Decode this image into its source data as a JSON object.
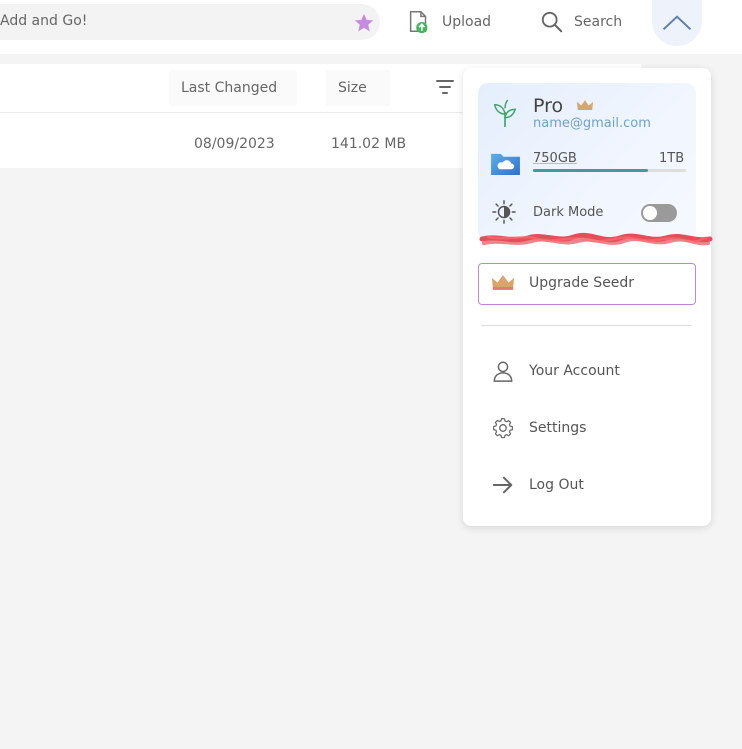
{
  "topbar": {
    "add_placeholder": "Add and Go!",
    "upload_label": "Upload",
    "search_label": "Search"
  },
  "table": {
    "columns": [
      "Last Changed",
      "Size"
    ],
    "rows": [
      {
        "date": "08/09/2023",
        "size": "141.02 MB"
      }
    ]
  },
  "account_menu": {
    "plan": "Pro",
    "email": "name@gmail.com",
    "storage": {
      "used": "750GB",
      "total": "1TB",
      "fraction": 0.75
    },
    "dark_mode": {
      "label": "Dark Mode",
      "enabled": false
    },
    "upgrade_label": "Upgrade Seedr",
    "items": [
      {
        "label": "Your Account",
        "icon": "user-icon"
      },
      {
        "label": "Settings",
        "icon": "gear-icon"
      },
      {
        "label": "Log Out",
        "icon": "arrow-right-icon"
      }
    ]
  },
  "colors": {
    "accent_star": "#c58be0",
    "crown": "#d9a66a",
    "email": "#6fa3c9",
    "storage_fill": "#3a9e9a",
    "upgrade_border": "#b98ad3"
  }
}
